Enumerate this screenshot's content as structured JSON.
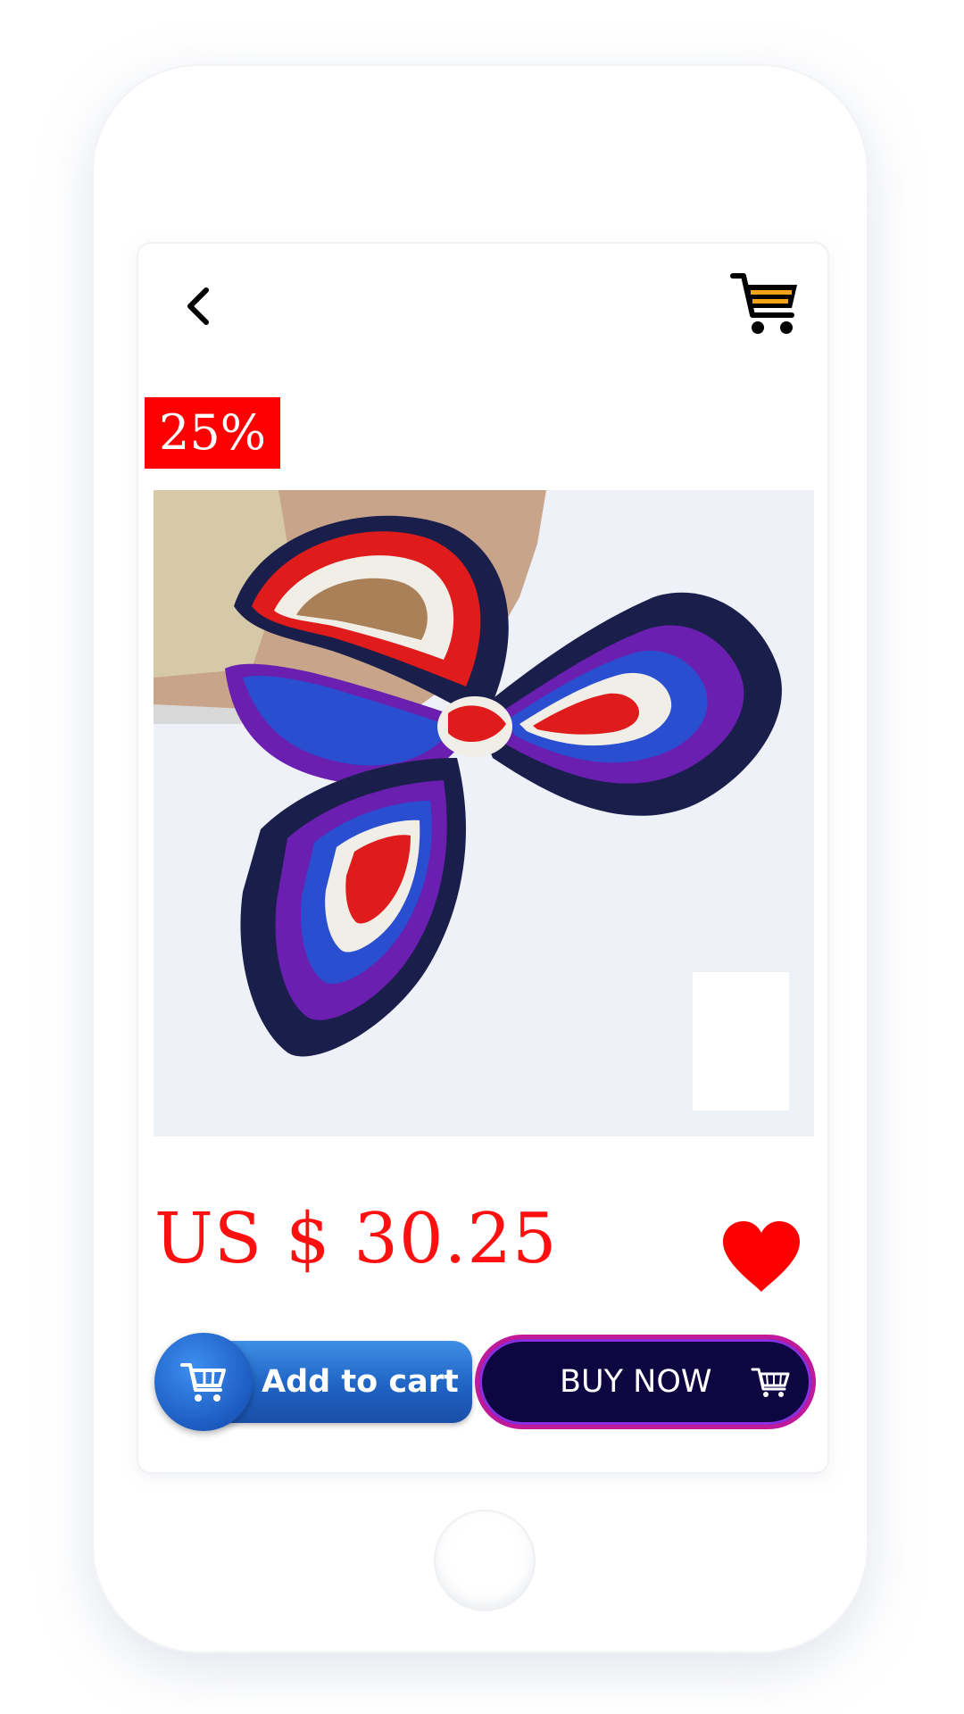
{
  "product": {
    "discount_badge": "25%",
    "price": "US $ 30.25",
    "image_icon": "silk-scarf-image"
  },
  "actions": {
    "add_to_cart_label": "Add to cart",
    "buy_now_label": "BUY NOW"
  },
  "icons": {
    "back": "chevron-left-icon",
    "cart": "shopping-cart-icon",
    "favorite": "heart-icon"
  },
  "colors": {
    "accent_red": "#ff0000",
    "add_to_cart_blue": "#1f63c3",
    "buy_now_navy": "#0d0640",
    "buy_now_border": "#c01a9a"
  }
}
